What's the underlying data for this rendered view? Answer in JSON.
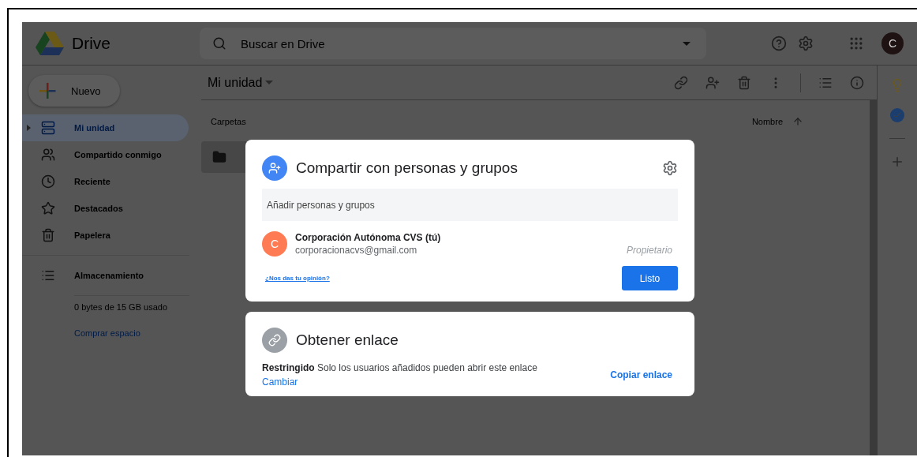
{
  "header": {
    "logo_text": "Drive",
    "search": {
      "placeholder": "Buscar en Drive"
    },
    "avatar_letter": "C"
  },
  "sidebar": {
    "new_button": "Nuevo",
    "items": [
      {
        "label": "Mi unidad",
        "selected": true
      },
      {
        "label": "Compartido conmigo",
        "selected": false
      },
      {
        "label": "Reciente",
        "selected": false
      },
      {
        "label": "Destacados",
        "selected": false
      },
      {
        "label": "Papelera",
        "selected": false
      }
    ],
    "storage": {
      "label": "Almacenamiento",
      "usage": "0 bytes de 15 GB usado",
      "buy_link": "Comprar espacio"
    }
  },
  "main": {
    "title": "Mi unidad",
    "section": "Carpetas",
    "sort_label": "Nombre"
  },
  "share_dialog": {
    "title": "Compartir con personas y grupos",
    "add_field": {
      "placeholder": "Añadir personas y grupos"
    },
    "person": {
      "avatar_letter": "C",
      "name": "Corporación Autónoma CVS (tú)",
      "email": "corporacionacvs@gmail.com",
      "role": "Propietario"
    },
    "feedback_link": "¿Nos das tu opinión?",
    "done_button": "Listo"
  },
  "link_dialog": {
    "title": "Obtener enlace",
    "description": "**Restringido** Solo los usuarios añadidos pueden abrir este enlace",
    "change_link": "Cambiar",
    "copy_link": "Copiar enlace"
  }
}
